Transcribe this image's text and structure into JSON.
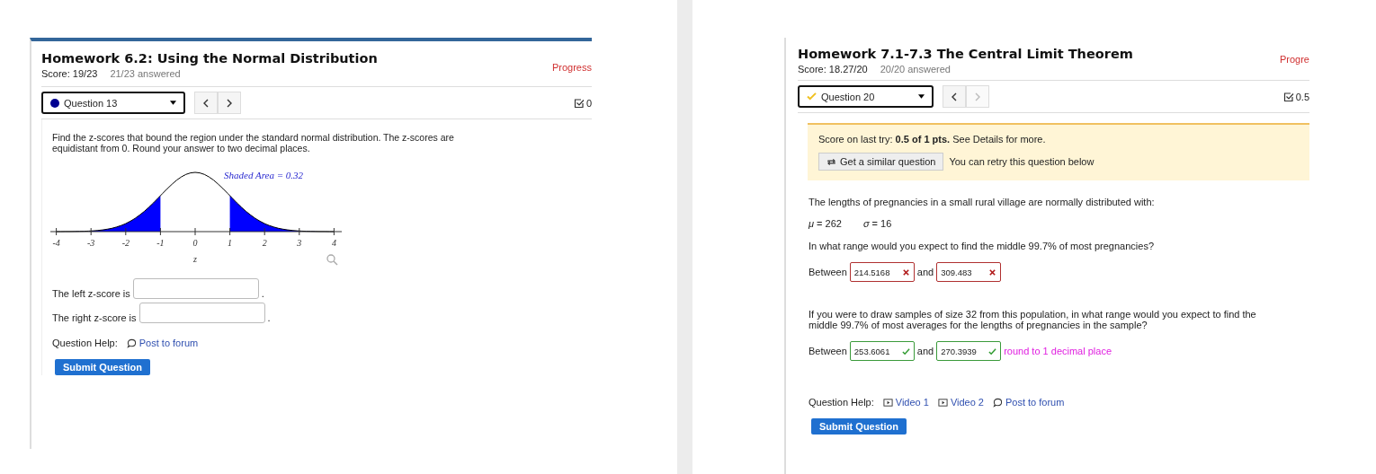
{
  "left_assignment": {
    "title": "Homework 6.2: Using the Normal Distribution",
    "score": "Score: 19/23",
    "answered": "21/23 answered",
    "progress": "Progress",
    "question_select": {
      "label": "Question 13",
      "kind": "unanswered"
    },
    "prev_disabled": false,
    "next_disabled": false,
    "points": "0",
    "prompt": "Find the z-scores that bound the region under the standard normal distribution. The z-scores are equidistant from 0. Round your answer to two decimal places.",
    "graph": {
      "caption": "Shaded Area = 0.32",
      "tick_labels": [
        "-4",
        "-3",
        "-2",
        "-1",
        "0",
        "1",
        "2",
        "3",
        "4"
      ],
      "axis_label": "z"
    },
    "answers": [
      {
        "label": "The left z-score is",
        "suffix": "."
      },
      {
        "label": "The right z-score is",
        "suffix": "."
      }
    ],
    "help_label": "Question Help:",
    "help_links": [
      {
        "kind": "forum",
        "label": "Post to forum"
      }
    ],
    "submit": "Submit Question"
  },
  "right_assignment": {
    "title": "Homework 7.1-7.3 The Central Limit Theorem",
    "score": "Score: 18.27/20",
    "answered": "20/20 answered",
    "progress": "Progre",
    "question_select": {
      "label": "Question 20",
      "kind": "partial"
    },
    "prev_disabled": false,
    "next_disabled": true,
    "points": "0.5",
    "notice": {
      "text": "Score on last try: **0.5 of 1 pts.** See Details for more.",
      "button": "Get a similar question",
      "note": "You can retry this question below"
    },
    "intro": "The lengths of pregnancies in a small rural village are normally distributed with:",
    "parameters": [
      "*μ* =  262",
      "*σ* =  16"
    ],
    "parts": [
      {
        "question": "In what range would you expect to find the middle 99.7% of most pregnancies?",
        "lead": "Between",
        "joiner": "and",
        "inputs": [
          {
            "value": "214.5168",
            "correct": false
          },
          {
            "value": "309.483",
            "correct": false
          }
        ]
      },
      {
        "question": "If you were to draw samples of size 32 from this population, in what range would you expect to find the middle 99.7% of most averages for the lengths of pregnancies in the sample?",
        "lead": "Between",
        "joiner": "and",
        "inputs": [
          {
            "value": "253.6061",
            "correct": true
          },
          {
            "value": "270.3939",
            "correct": true
          }
        ],
        "hint": "round to 1 decimal place"
      }
    ],
    "help_label": "Question Help:",
    "help_links": [
      {
        "kind": "video",
        "label": "Video 1"
      },
      {
        "kind": "video",
        "label": "Video 2"
      },
      {
        "kind": "forum",
        "label": "Post to forum"
      }
    ],
    "submit": "Submit Question"
  }
}
